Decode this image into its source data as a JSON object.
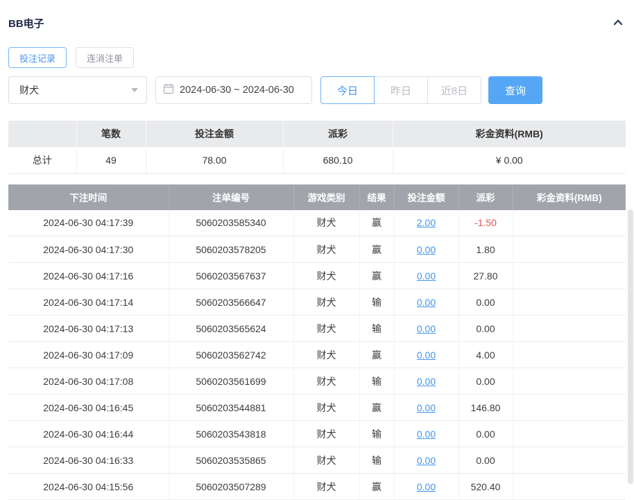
{
  "colors": {
    "accent_blue": "#55a7f6",
    "link_blue": "#3f94ee",
    "negative_red": "#e45656",
    "table_header_gray": "#a1a5ab"
  },
  "header": {
    "title": "BB电子"
  },
  "tabs": {
    "bet_records": "投注记录",
    "chain_cancel": "连消注单"
  },
  "filters": {
    "game_select": {
      "value": "财犬"
    },
    "date_range": {
      "value": "2024-06-30 ~ 2024-06-30"
    },
    "quick": {
      "today": "今日",
      "yesterday": "昨日",
      "last8days": "近8日"
    },
    "search": "查询"
  },
  "summary": {
    "headers": {
      "count": "笔数",
      "bet_amount": "投注金额",
      "payout": "派彩",
      "bonus": "彩金资料(RMB)"
    },
    "total": {
      "label": "总计",
      "count": "49",
      "bet_amount": "78.00",
      "payout": "680.10",
      "bonus": "¥ 0.00"
    }
  },
  "table": {
    "headers": [
      "下注时间",
      "注单编号",
      "游戏类别",
      "结果",
      "投注金额",
      "派彩",
      "彩金资料(RMB)"
    ],
    "rows": [
      {
        "time": "2024-06-30 04:17:39",
        "order_id": "5060203585340",
        "game": "财犬",
        "result": "赢",
        "bet": "2.00",
        "payout": "-1.50",
        "payout_negative": true,
        "bonus": ""
      },
      {
        "time": "2024-06-30 04:17:30",
        "order_id": "5060203578205",
        "game": "财犬",
        "result": "赢",
        "bet": "0.00",
        "payout": "1.80",
        "payout_negative": false,
        "bonus": ""
      },
      {
        "time": "2024-06-30 04:17:16",
        "order_id": "5060203567637",
        "game": "财犬",
        "result": "赢",
        "bet": "0.00",
        "payout": "27.80",
        "payout_negative": false,
        "bonus": ""
      },
      {
        "time": "2024-06-30 04:17:14",
        "order_id": "5060203566647",
        "game": "财犬",
        "result": "输",
        "bet": "0.00",
        "payout": "0.00",
        "payout_negative": false,
        "bonus": ""
      },
      {
        "time": "2024-06-30 04:17:13",
        "order_id": "5060203565624",
        "game": "财犬",
        "result": "输",
        "bet": "0.00",
        "payout": "0.00",
        "payout_negative": false,
        "bonus": ""
      },
      {
        "time": "2024-06-30 04:17:09",
        "order_id": "5060203562742",
        "game": "财犬",
        "result": "赢",
        "bet": "0.00",
        "payout": "4.00",
        "payout_negative": false,
        "bonus": ""
      },
      {
        "time": "2024-06-30 04:17:08",
        "order_id": "5060203561699",
        "game": "财犬",
        "result": "输",
        "bet": "0.00",
        "payout": "0.00",
        "payout_negative": false,
        "bonus": ""
      },
      {
        "time": "2024-06-30 04:16:45",
        "order_id": "5060203544881",
        "game": "财犬",
        "result": "赢",
        "bet": "0.00",
        "payout": "146.80",
        "payout_negative": false,
        "bonus": ""
      },
      {
        "time": "2024-06-30 04:16:44",
        "order_id": "5060203543818",
        "game": "财犬",
        "result": "输",
        "bet": "0.00",
        "payout": "0.00",
        "payout_negative": false,
        "bonus": ""
      },
      {
        "time": "2024-06-30 04:16:33",
        "order_id": "5060203535865",
        "game": "财犬",
        "result": "输",
        "bet": "0.00",
        "payout": "0.00",
        "payout_negative": false,
        "bonus": ""
      },
      {
        "time": "2024-06-30 04:15:56",
        "order_id": "5060203507289",
        "game": "财犬",
        "result": "赢",
        "bet": "0.00",
        "payout": "520.40",
        "payout_negative": false,
        "bonus": ""
      }
    ]
  }
}
